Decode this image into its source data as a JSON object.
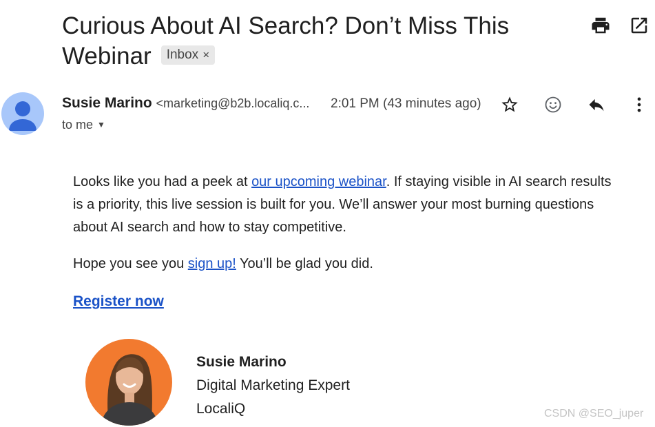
{
  "email": {
    "subject": "Curious About AI Search? Don’t Miss This Webinar",
    "label": "Inbox",
    "label_remove": "×",
    "sender_name": "Susie Marino",
    "sender_email": "<marketing@b2b.localiq.c...",
    "time": "2:01 PM (43 minutes ago)",
    "recipient": "to me"
  },
  "icons": {
    "print": "print-icon",
    "open_new_window": "open-in-new-window-icon",
    "avatar": "person-avatar-icon",
    "star": "star-icon",
    "emoji": "emoji-reaction-icon",
    "reply": "reply-icon",
    "more": "more-vert-icon",
    "dropdown": "caret-down-icon"
  },
  "body": {
    "p1_before": "Looks like you had a peek at ",
    "p1_link": "our upcoming webinar",
    "p1_after": ". If staying visible in AI search results is a priority, this live session is built for you. We’ll answer your most burning questions about AI search and how to stay competitive.",
    "p2_before": "Hope you see you ",
    "p2_link": "sign up!",
    "p2_after": " You’ll be glad you did.",
    "cta": "Register now"
  },
  "signature": {
    "name": "Susie Marino",
    "title": "Digital Marketing Expert",
    "company": "LocaliQ"
  },
  "watermark": "CSDN @SEO_juper",
  "colors": {
    "link": "#1a52c7",
    "avatar_bg": "#a8c7fa",
    "avatar_fg": "#3367d6",
    "signature_bg": "#f27a2f"
  }
}
